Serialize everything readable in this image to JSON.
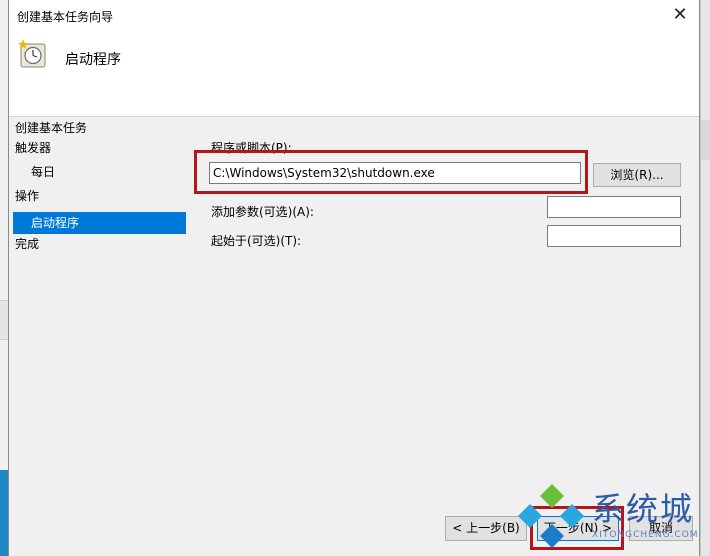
{
  "window": {
    "title": "创建基本任务向导",
    "close_glyph": "✕"
  },
  "header": {
    "heading": "启动程序",
    "icon": "clock-icon"
  },
  "sidebar": {
    "items": [
      {
        "label": "创建基本任务"
      },
      {
        "label": "触发器"
      },
      {
        "label": "每日"
      },
      {
        "label": "操作"
      },
      {
        "label": "启动程序"
      },
      {
        "label": "完成"
      }
    ]
  },
  "form": {
    "program_label": "程序或脚本(P):",
    "program_value": "C:\\Windows\\System32\\shutdown.exe",
    "browse_label": "浏览(R)...",
    "args_label": "添加参数(可选)(A):",
    "args_value": "",
    "startin_label": "起始于(可选)(T):",
    "startin_value": ""
  },
  "footer": {
    "back_label": "< 上一步(B)",
    "next_label": "下一步(N) >",
    "cancel_label": "取消"
  },
  "watermark": {
    "text": "系统城",
    "sub": "XITONGCHENG.COM"
  },
  "colors": {
    "accent": "#0078d7",
    "highlight": "#b3161a"
  }
}
